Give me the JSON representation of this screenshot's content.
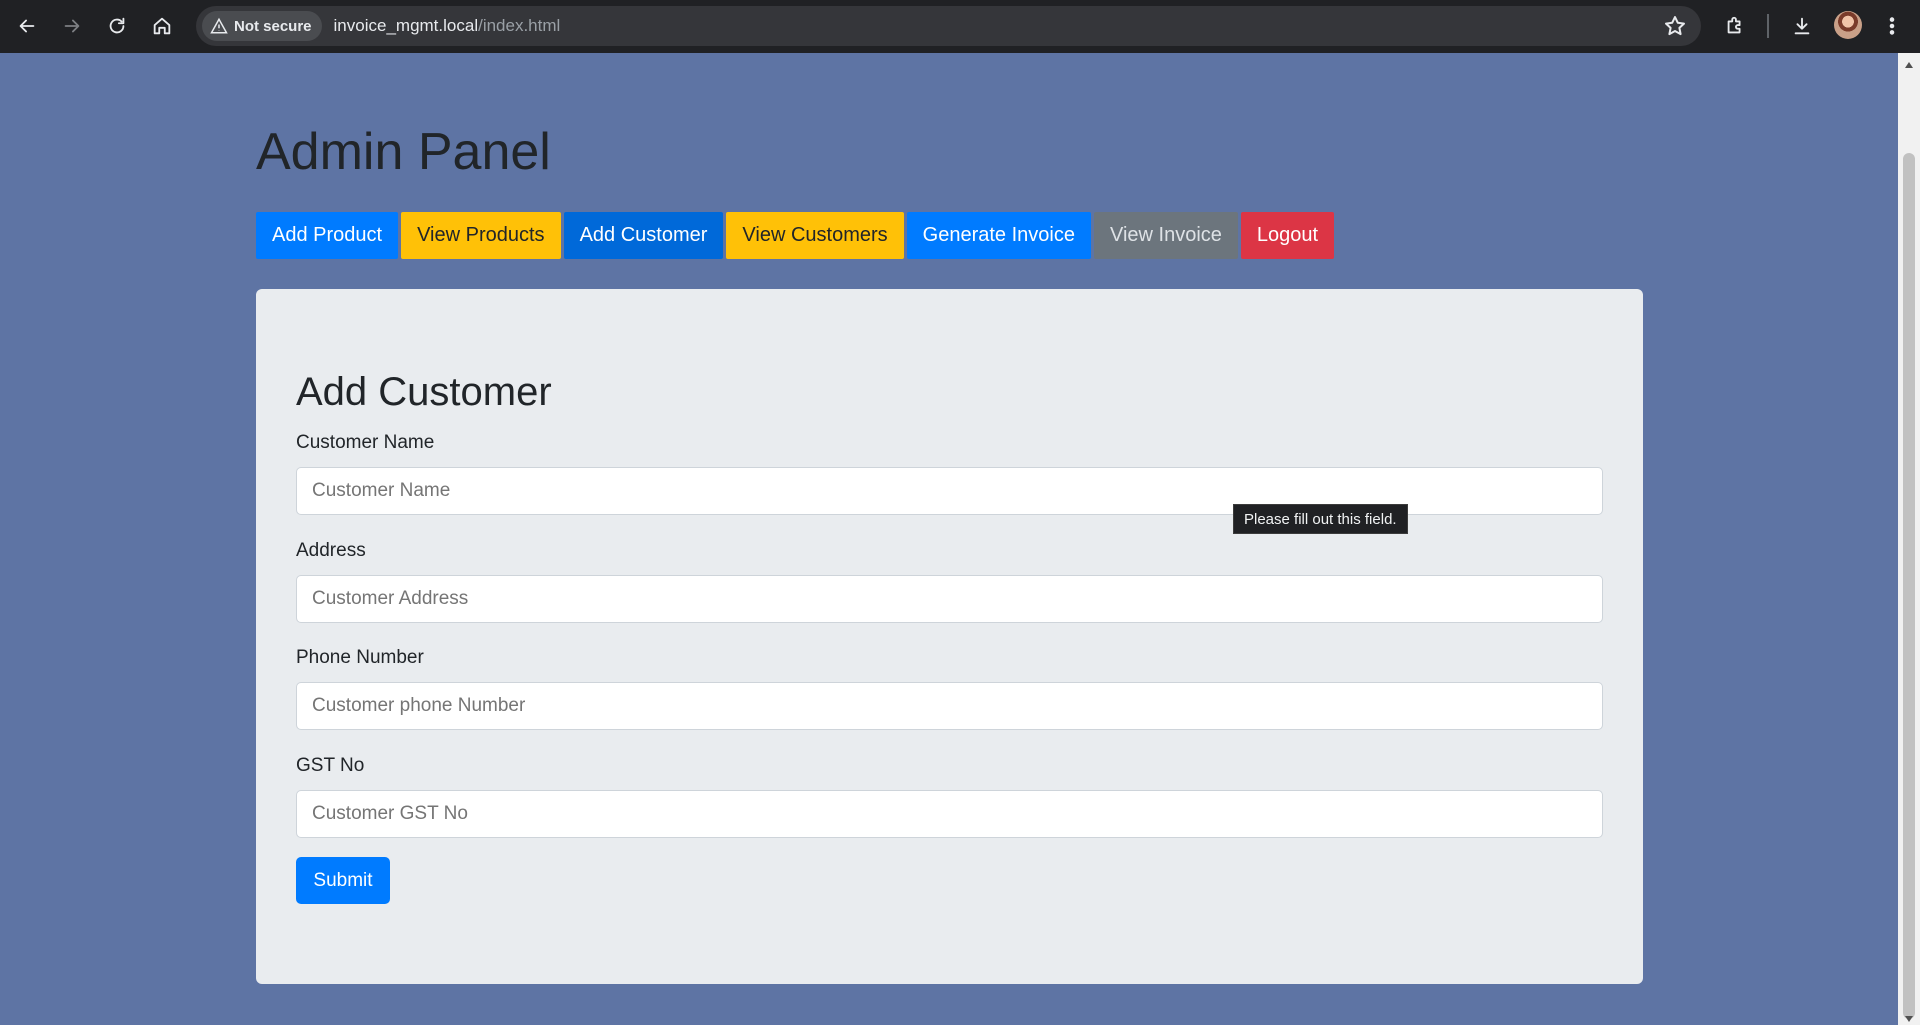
{
  "browser": {
    "security_label": "Not secure",
    "url_host": "invoice_mgmt.local",
    "url_path": "/index.html"
  },
  "page": {
    "title": "Admin Panel"
  },
  "nav": {
    "items": [
      {
        "label": "Add Product",
        "style": "primary"
      },
      {
        "label": "View Products",
        "style": "warning"
      },
      {
        "label": "Add Customer",
        "style": "primary-active"
      },
      {
        "label": "View Customers",
        "style": "warning"
      },
      {
        "label": "Generate Invoice",
        "style": "primary"
      },
      {
        "label": "View Invoice",
        "style": "secondary"
      },
      {
        "label": "Logout",
        "style": "danger"
      }
    ]
  },
  "form": {
    "title": "Add Customer",
    "fields": [
      {
        "label": "Customer Name",
        "placeholder": "Customer Name"
      },
      {
        "label": "Address",
        "placeholder": "Customer Address"
      },
      {
        "label": "Phone Number",
        "placeholder": "Customer phone Number"
      },
      {
        "label": "GST No",
        "placeholder": "Customer GST No"
      }
    ],
    "submit_label": "Submit"
  },
  "validation_tooltip": "Please fill out this field.",
  "colors": {
    "background": "#5e74a4",
    "primary": "#007bff",
    "warning": "#ffc107",
    "secondary": "#6c757d",
    "danger": "#dc3545",
    "card": "#e9ecef"
  }
}
